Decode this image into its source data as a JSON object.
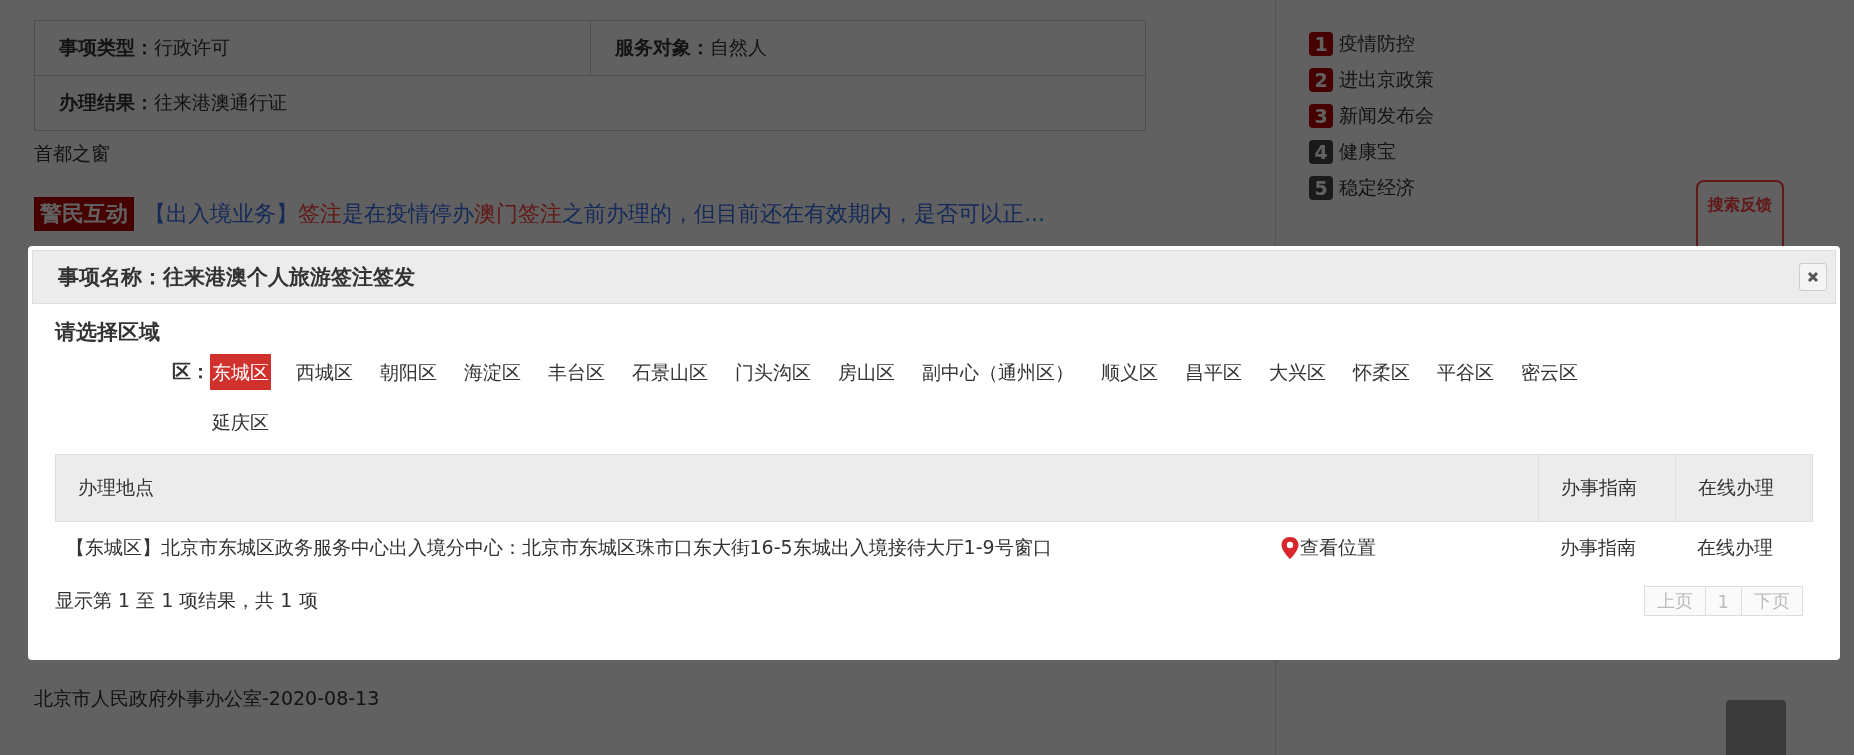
{
  "background_page": {
    "info_table": [
      {
        "label": "事项类型：",
        "value": "行政许可"
      },
      {
        "label": "服务对象：",
        "value": "自然人"
      },
      {
        "label": "办理结果：",
        "value": "往来港澳通行证"
      }
    ],
    "source": "首都之窗",
    "result": {
      "tag": "警民互动",
      "parts": [
        {
          "text": "【出入境业务】",
          "highlight": false
        },
        {
          "text": "签注",
          "highlight": true
        },
        {
          "text": "是在疫情停办",
          "highlight": false
        },
        {
          "text": "澳门签注",
          "highlight": true
        },
        {
          "text": "之前办理的，但目前还在有效期内，是否可以正...",
          "highlight": false
        }
      ]
    },
    "footer_source": "北京市人民政府外事办公室-2020-08-13",
    "hot_list": [
      {
        "rank": "1",
        "label": "疫情防控",
        "top": true
      },
      {
        "rank": "2",
        "label": "进出京政策",
        "top": true
      },
      {
        "rank": "3",
        "label": "新闻发布会",
        "top": true
      },
      {
        "rank": "4",
        "label": "健康宝",
        "top": false
      },
      {
        "rank": "5",
        "label": "稳定经济",
        "top": false
      }
    ],
    "feedback_button": "搜索反馈"
  },
  "dialog": {
    "title": "事项名称：往来港澳个人旅游签注签发",
    "section_title": "请选择区域",
    "district_label": "区：",
    "districts": [
      {
        "label": "东城区",
        "selected": true
      },
      {
        "label": "西城区",
        "selected": false
      },
      {
        "label": "朝阳区",
        "selected": false
      },
      {
        "label": "海淀区",
        "selected": false
      },
      {
        "label": "丰台区",
        "selected": false
      },
      {
        "label": "石景山区",
        "selected": false
      },
      {
        "label": "门头沟区",
        "selected": false
      },
      {
        "label": "房山区",
        "selected": false
      },
      {
        "label": "副中心（通州区）",
        "selected": false
      },
      {
        "label": "顺义区",
        "selected": false
      },
      {
        "label": "昌平区",
        "selected": false
      },
      {
        "label": "大兴区",
        "selected": false
      },
      {
        "label": "怀柔区",
        "selected": false
      },
      {
        "label": "平谷区",
        "selected": false
      },
      {
        "label": "密云区",
        "selected": false
      },
      {
        "label": "延庆区",
        "selected": false
      }
    ],
    "table": {
      "columns": [
        "办理地点",
        "办事指南",
        "在线办理"
      ],
      "rows": [
        {
          "address": "【东城区】北京市东城区政务服务中心出入境分中心：北京市东城区珠市口东大街16-5东城出入境接待大厅1-9号窗口",
          "location_link": "查看位置",
          "guide": "办事指南",
          "online": "在线办理"
        }
      ]
    },
    "summary": "显示第 1 至 1 项结果，共 1 项",
    "pagination": [
      {
        "label": "上页",
        "disabled": true
      },
      {
        "label": "1",
        "disabled": true
      },
      {
        "label": "下页",
        "disabled": true
      }
    ]
  }
}
